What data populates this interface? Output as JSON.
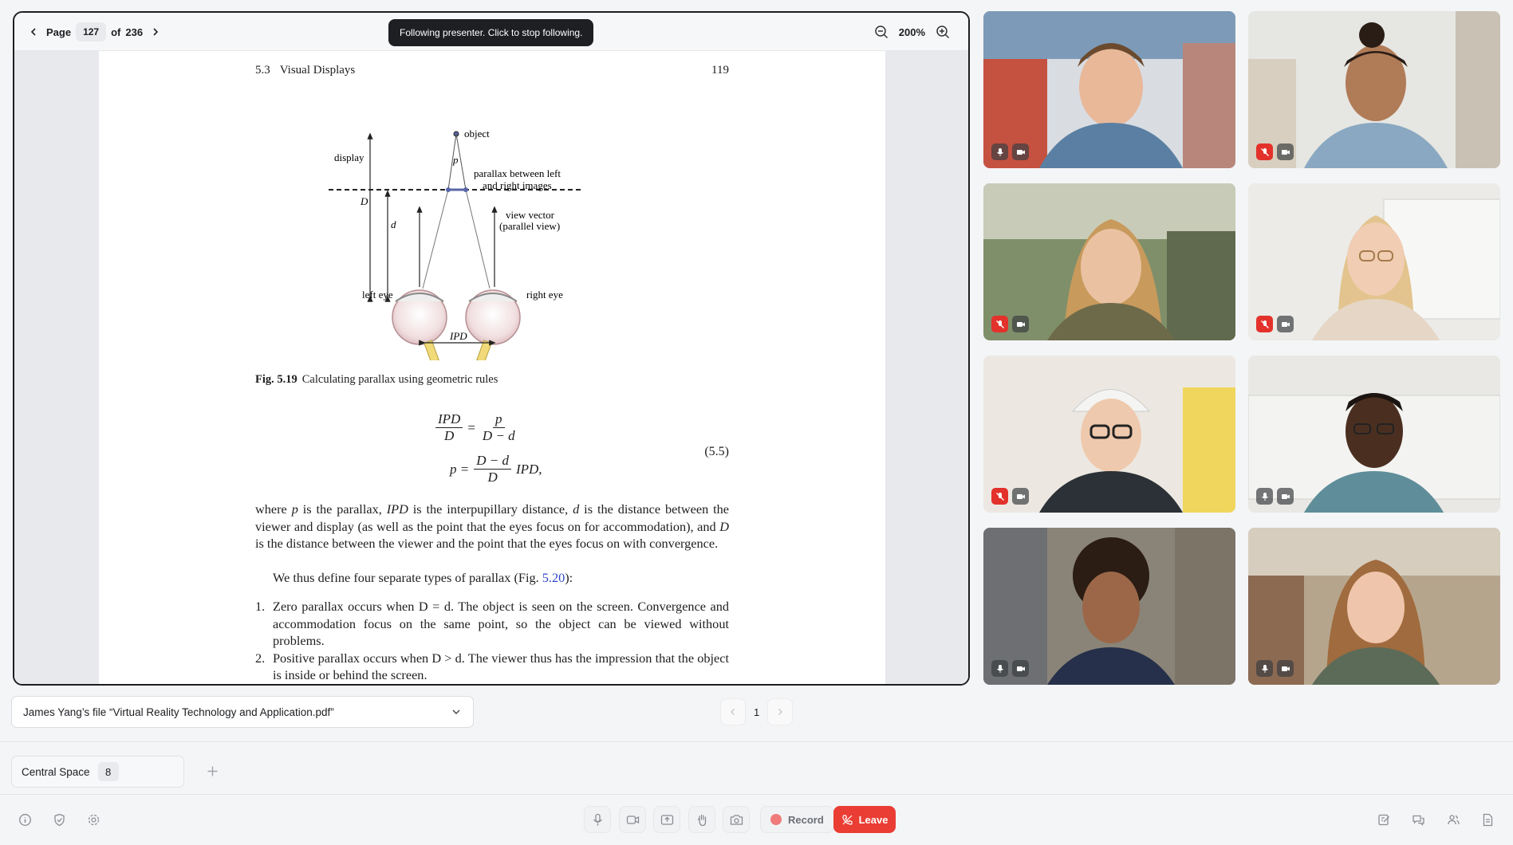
{
  "viewer": {
    "page_label": "Page",
    "current_page": "127",
    "of_label": "of",
    "total_pages": "236",
    "presenter_notice": "Following presenter. Click to stop following.",
    "zoom": "200%"
  },
  "pdf": {
    "section": "5.3",
    "section_title": "Visual Displays",
    "page_number": "119",
    "figure_labels": {
      "object": "object",
      "display": "display",
      "p": "p",
      "parallax_line1": "parallax between left",
      "parallax_line2": "and right images",
      "view_vector_line1": "view vector",
      "view_vector_line2": "(parallel view)",
      "D": "D",
      "d": "d",
      "left_eye": "left eye",
      "right_eye": "right eye",
      "ipd": "IPD"
    },
    "fig_label": "Fig. 5.19",
    "fig_caption": "Calculating parallax using geometric rules",
    "equation": {
      "lhs1_num": "IPD",
      "lhs1_den": "D",
      "eq": "=",
      "rhs1_num": "p",
      "rhs1_den": "D − d",
      "lhs2": "p =",
      "rhs2_num": "D − d",
      "rhs2_den": "D",
      "rhs2_tail": "IPD,",
      "number": "(5.5)"
    },
    "para1": {
      "t1": "where ",
      "i1": "p",
      "t2": " is the parallax, ",
      "i2": "IPD",
      "t3": " is the interpupillary distance, ",
      "i3": "d",
      "t4": " is the distance between the viewer and display (as well as the point that the eyes focus on for accommodation), and ",
      "i4": "D",
      "t5": " is the distance between the viewer and the point that the eyes focus on with convergence."
    },
    "para2": {
      "t1": "We thus define four separate types of parallax (Fig. ",
      "link": "5.20",
      "t2": "):"
    },
    "list": [
      {
        "n": "1.",
        "term": "Zero parallax",
        "t1": " occurs when ",
        "cond": "D = d",
        "t2": ". The object is seen on the screen. Convergence and accommodation focus on the same point, so the object can be viewed without problems."
      },
      {
        "n": "2.",
        "term": "Positive parallax",
        "t1": " occurs when ",
        "cond": "D > d",
        "t2": ". The viewer thus has the impression that the object is inside or behind the screen."
      }
    ]
  },
  "participants": [
    {
      "mic_muted": false,
      "cam": "camera-icon"
    },
    {
      "mic_muted": true,
      "cam": "camera-icon"
    },
    {
      "mic_muted": true,
      "cam": "camera-icon"
    },
    {
      "mic_muted": true,
      "cam": "camera-icon"
    },
    {
      "mic_muted": true,
      "cam": "camera-icon"
    },
    {
      "mic_muted": false,
      "cam": "camera-icon"
    },
    {
      "mic_muted": false,
      "cam": "camera-icon"
    },
    {
      "mic_muted": false,
      "cam": "camera-icon"
    }
  ],
  "file_select": {
    "label": "James Yang’s file “Virtual Reality Technology and Application.pdf”"
  },
  "slide_pager": {
    "current": "1"
  },
  "space": {
    "name": "Central Space",
    "count": "8"
  },
  "controls": {
    "record_label": "Record",
    "leave_label": "Leave"
  },
  "colors": {
    "leave": "#ea3d34",
    "muted": "#e3322b",
    "link": "#2d47c9"
  }
}
